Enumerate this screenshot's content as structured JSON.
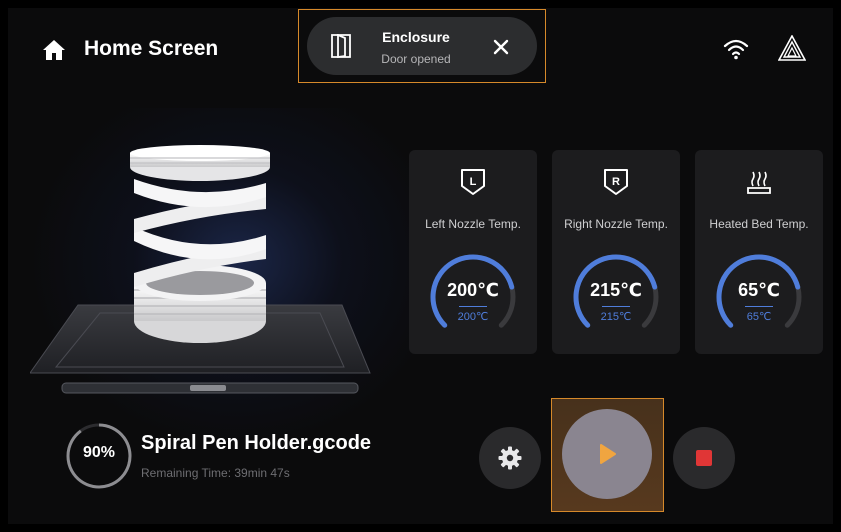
{
  "header": {
    "title": "Home Screen"
  },
  "notification": {
    "title": "Enclosure",
    "message": "Door opened"
  },
  "temperatures": [
    {
      "icon": "left-nozzle-icon",
      "badge": "L",
      "label": "Left Nozzle Temp.",
      "current": "200℃",
      "target": "200℃",
      "level": 1.0
    },
    {
      "icon": "right-nozzle-icon",
      "badge": "R",
      "label": "Right Nozzle Temp.",
      "current": "215℃",
      "target": "215℃",
      "level": 1.0
    },
    {
      "icon": "heated-bed-icon",
      "badge": "",
      "label": "Heated Bed Temp.",
      "current": "65℃",
      "target": "65℃",
      "level": 1.0
    }
  ],
  "job": {
    "progress_percent": 90,
    "progress_label": "90%",
    "filename": "Spiral Pen Holder.gcode",
    "remaining": "Remaining Time: 39min 47s"
  },
  "controls": {
    "settings_icon": "gear-icon",
    "play_icon": "play-icon",
    "stop_icon": "stop-icon"
  },
  "colors": {
    "accent_blue": "#4f7ddb",
    "highlight_orange": "#d6892a",
    "stop_red": "#e03636"
  }
}
